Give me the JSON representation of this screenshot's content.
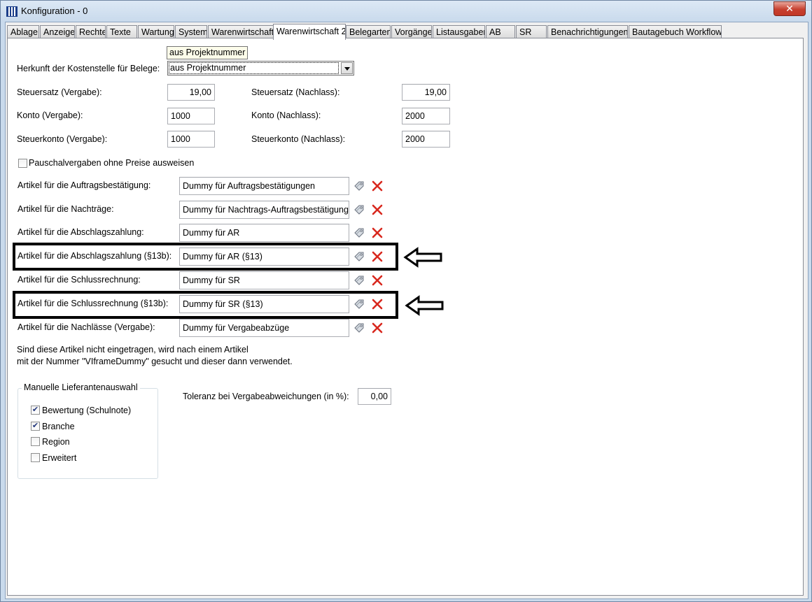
{
  "window": {
    "title": "Konfiguration - 0",
    "close_glyph": "✕"
  },
  "tabs": [
    {
      "label": "Ablage"
    },
    {
      "label": "Anzeige"
    },
    {
      "label": "Rechte"
    },
    {
      "label": "Texte"
    },
    {
      "label": "Wartung"
    },
    {
      "label": "System"
    },
    {
      "label": "Warenwirtschaft"
    },
    {
      "label": "Warenwirtschaft 2",
      "active": true
    },
    {
      "label": "Belegarten"
    },
    {
      "label": "Vorgänge"
    },
    {
      "label": "Listausgaben"
    },
    {
      "label": "AB"
    },
    {
      "label": "SR"
    },
    {
      "label": "Benachrichtigungen"
    },
    {
      "label": "Bautagebuch Workflows"
    }
  ],
  "kostenstelle": {
    "label": "Herkunft der Kostenstelle für Belege:",
    "value": "aus Projektnummer",
    "tooltip": "aus Projektnummer"
  },
  "fields": {
    "steuersatz_vergabe": {
      "label": "Steuersatz (Vergabe):",
      "value": "19,00"
    },
    "steuersatz_nachlass": {
      "label": "Steuersatz (Nachlass):",
      "value": "19,00"
    },
    "konto_vergabe": {
      "label": "Konto (Vergabe):",
      "value": "1000"
    },
    "konto_nachlass": {
      "label": "Konto (Nachlass):",
      "value": "2000"
    },
    "steuerkonto_vergabe": {
      "label": "Steuerkonto (Vergabe):",
      "value": "1000"
    },
    "steuerkonto_nachlass": {
      "label": "Steuerkonto (Nachlass):",
      "value": "2000"
    }
  },
  "pauschal": {
    "label": "Pauschalvergaben ohne Preise ausweisen",
    "checked": false
  },
  "articles": [
    {
      "label": "Artikel für die Auftragsbestätigung:",
      "value": "Dummy für Auftragsbestätigungen",
      "highlighted": false
    },
    {
      "label": "Artikel für die Nachträge:",
      "value": "Dummy für Nachtrags-Auftragsbestätigunge",
      "highlighted": false
    },
    {
      "label": "Artikel für die Abschlagszahlung:",
      "value": "Dummy für AR",
      "highlighted": false
    },
    {
      "label": "Artikel für die Abschlagszahlung (§13b):",
      "value": "Dummy für AR (§13)",
      "highlighted": true
    },
    {
      "label": "Artikel für die Schlussrechnung:",
      "value": "Dummy für SR",
      "highlighted": false
    },
    {
      "label": "Artikel für die Schlussrechnung (§13b):",
      "value": "Dummy für SR  (§13)",
      "highlighted": true
    },
    {
      "label": "Artikel für die Nachlässe (Vergabe):",
      "value": "Dummy für Vergabeabzüge",
      "highlighted": false
    }
  ],
  "note": {
    "line1": "Sind diese Artikel nicht eingetragen, wird nach einem Artikel",
    "line2": "mit der Nummer \"VIframeDummy\" gesucht und dieser dann verwendet."
  },
  "lieferanten": {
    "title": "Manuelle Lieferantenauswahl",
    "options": [
      {
        "label": "Bewertung (Schulnote)",
        "checked": true
      },
      {
        "label": "Branche",
        "checked": true
      },
      {
        "label": "Region",
        "checked": false
      },
      {
        "label": "Erweitert",
        "checked": false
      }
    ]
  },
  "toleranz": {
    "label": "Toleranz bei Vergabeabweichungen (in %):",
    "value": "0,00"
  },
  "icons": {
    "assign": "tag-icon",
    "delete": "delete-x-icon",
    "annotation": "arrow-left-icon"
  },
  "colors": {
    "delete_red": "#d8281e",
    "tab_border": "#898c95",
    "highlight": "#000000"
  }
}
